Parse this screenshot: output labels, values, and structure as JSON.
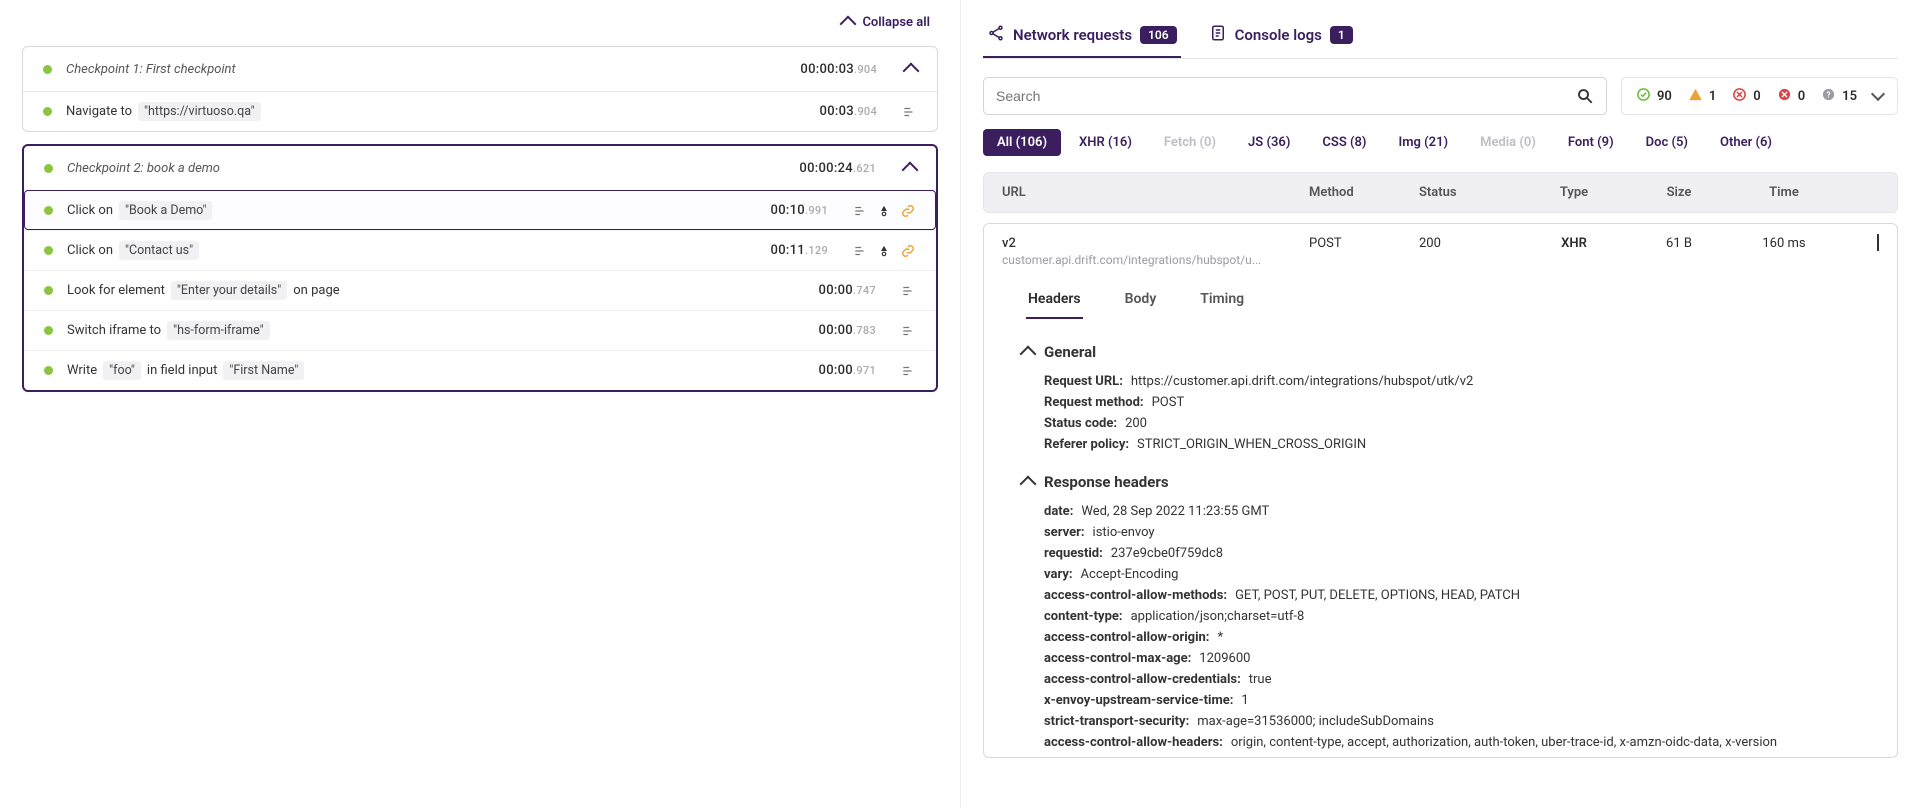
{
  "left": {
    "collapse_all": "Collapse all",
    "checkpoints": [
      {
        "title": "Checkpoint 1: First checkpoint",
        "time": "00:00:03",
        "time_ms": ".904",
        "active": false,
        "steps": [
          {
            "parts": [
              "Navigate to"
            ],
            "pills": [
              "\"https://virtuoso.qa\""
            ],
            "time": "00:03",
            "time_ms": ".904",
            "icons": [
              "steps"
            ]
          }
        ]
      },
      {
        "title": "Checkpoint 2: book a demo",
        "time": "00:00:24",
        "time_ms": ".621",
        "active": true,
        "steps": [
          {
            "selected": true,
            "parts": [
              "Click on"
            ],
            "pills": [
              "\"Book a Demo\""
            ],
            "time": "00:10",
            "time_ms": ".991",
            "icons": [
              "steps",
              "bug",
              "link"
            ]
          },
          {
            "parts": [
              "Click on"
            ],
            "pills": [
              "\"Contact us\""
            ],
            "time": "00:11",
            "time_ms": ".129",
            "icons": [
              "steps",
              "bug",
              "link"
            ]
          },
          {
            "parts": [
              "Look for element"
            ],
            "pills": [
              "\"Enter your details\""
            ],
            "tail": "on page",
            "time": "00:00",
            "time_ms": ".747",
            "icons": [
              "steps"
            ]
          },
          {
            "parts": [
              "Switch iframe to"
            ],
            "pills": [
              "\"hs-form-iframe\""
            ],
            "time": "00:00",
            "time_ms": ".783",
            "icons": [
              "steps"
            ]
          },
          {
            "parts": [
              "Write"
            ],
            "pills": [
              "\"foo\""
            ],
            "mid": "in field input",
            "pills2": [
              "\"First Name\""
            ],
            "time": "00:00",
            "time_ms": ".971",
            "icons": [
              "steps"
            ]
          }
        ]
      }
    ]
  },
  "right": {
    "tabs": [
      {
        "icon": "share",
        "label": "Network requests",
        "badge": "106",
        "active": true
      },
      {
        "icon": "doc",
        "label": "Console logs",
        "badge": "1",
        "active": false
      }
    ],
    "search_placeholder": "Search",
    "stats": [
      {
        "kind": "ok",
        "value": "90"
      },
      {
        "kind": "warn",
        "value": "1"
      },
      {
        "kind": "err",
        "value": "0"
      },
      {
        "kind": "fail",
        "value": "0"
      },
      {
        "kind": "unknown",
        "value": "15"
      }
    ],
    "filters": [
      {
        "label": "All (106)",
        "active": true
      },
      {
        "label": "XHR (16)"
      },
      {
        "label": "Fetch (0)",
        "dim": true
      },
      {
        "label": "JS (36)"
      },
      {
        "label": "CSS (8)"
      },
      {
        "label": "Img (21)"
      },
      {
        "label": "Media (0)",
        "dim": true
      },
      {
        "label": "Font (9)"
      },
      {
        "label": "Doc (5)"
      },
      {
        "label": "Other (6)"
      }
    ],
    "columns": {
      "url": "URL",
      "method": "Method",
      "status": "Status",
      "type": "Type",
      "size": "Size",
      "time": "Time"
    },
    "request": {
      "url_main": "v2",
      "url_sub": "customer.api.drift.com/integrations/hubspot/u...",
      "method": "POST",
      "status": "200",
      "type": "XHR",
      "size": "61 B",
      "time": "160 ms",
      "subtabs": [
        "Headers",
        "Body",
        "Timing"
      ],
      "general_label": "General",
      "general": [
        {
          "k": "Request URL:",
          "v": "https://customer.api.drift.com/integrations/hubspot/utk/v2"
        },
        {
          "k": "Request method:",
          "v": "POST"
        },
        {
          "k": "Status code:",
          "v": "200"
        },
        {
          "k": "Referer policy:",
          "v": "STRICT_ORIGIN_WHEN_CROSS_ORIGIN"
        }
      ],
      "response_label": "Response headers",
      "response": [
        {
          "k": "date:",
          "v": "Wed, 28 Sep 2022 11:23:55 GMT"
        },
        {
          "k": "server:",
          "v": "istio-envoy"
        },
        {
          "k": "requestid:",
          "v": "237e9cbe0f759dc8"
        },
        {
          "k": "vary:",
          "v": "Accept-Encoding"
        },
        {
          "k": "access-control-allow-methods:",
          "v": "GET, POST, PUT, DELETE, OPTIONS, HEAD, PATCH"
        },
        {
          "k": "content-type:",
          "v": "application/json;charset=utf-8"
        },
        {
          "k": "access-control-allow-origin:",
          "v": "*"
        },
        {
          "k": "access-control-max-age:",
          "v": "1209600"
        },
        {
          "k": "access-control-allow-credentials:",
          "v": "true"
        },
        {
          "k": "x-envoy-upstream-service-time:",
          "v": "1"
        },
        {
          "k": "strict-transport-security:",
          "v": "max-age=31536000; includeSubDomains"
        },
        {
          "k": "access-control-allow-headers:",
          "v": "origin, content-type, accept, authorization, auth-token, uber-trace-id, x-amzn-oidc-data, x-version"
        }
      ]
    }
  }
}
